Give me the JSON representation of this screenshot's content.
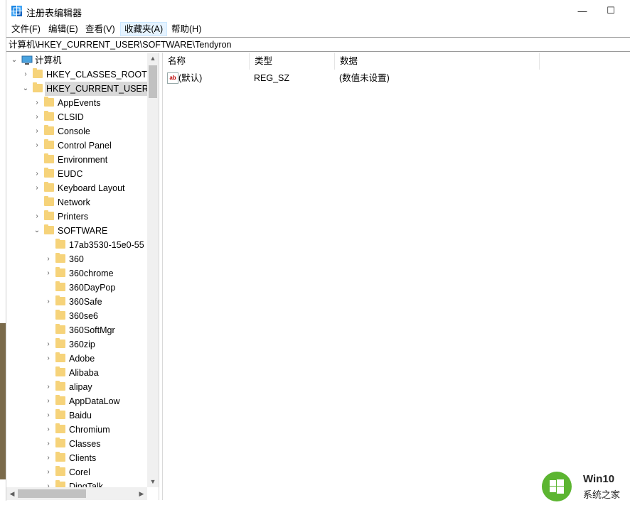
{
  "window": {
    "title": "注册表编辑器",
    "minimize_glyph": "—",
    "maximize_glyph": "☐"
  },
  "menu": [
    "文件(F)",
    "编辑(E)",
    "查看(V)",
    "收藏夹(A)",
    "帮助(H)"
  ],
  "address": "计算机\\HKEY_CURRENT_USER\\SOFTWARE\\Tendyron",
  "tree": {
    "root": "计算机",
    "hives": [
      "HKEY_CLASSES_ROOT",
      "HKEY_CURRENT_USER"
    ],
    "hkcu_children": [
      "AppEvents",
      "CLSID",
      "Console",
      "Control Panel",
      "Environment",
      "EUDC",
      "Keyboard Layout",
      "Network",
      "Printers",
      "SOFTWARE"
    ],
    "software_children": [
      "17ab3530-15e0-55",
      "360",
      "360chrome",
      "360DayPop",
      "360Safe",
      "360se6",
      "360SoftMgr",
      "360zip",
      "Adobe",
      "Alibaba",
      "alipay",
      "AppDataLow",
      "Baidu",
      "Chromium",
      "Classes",
      "Clients",
      "Corel",
      "DingTalk"
    ]
  },
  "list": {
    "columns": [
      "名称",
      "类型",
      "数据"
    ],
    "rows": [
      {
        "name": "(默认)",
        "type": "REG_SZ",
        "data": "(数值未设置)"
      }
    ]
  },
  "watermark": {
    "name": "Win10",
    "subtitle": "系统之家"
  },
  "colors": {
    "folder": "#f6d37a",
    "selection": "#d9d9d9",
    "menu_highlight": "#e5f3ff",
    "watermark_green": "#5cb531"
  }
}
